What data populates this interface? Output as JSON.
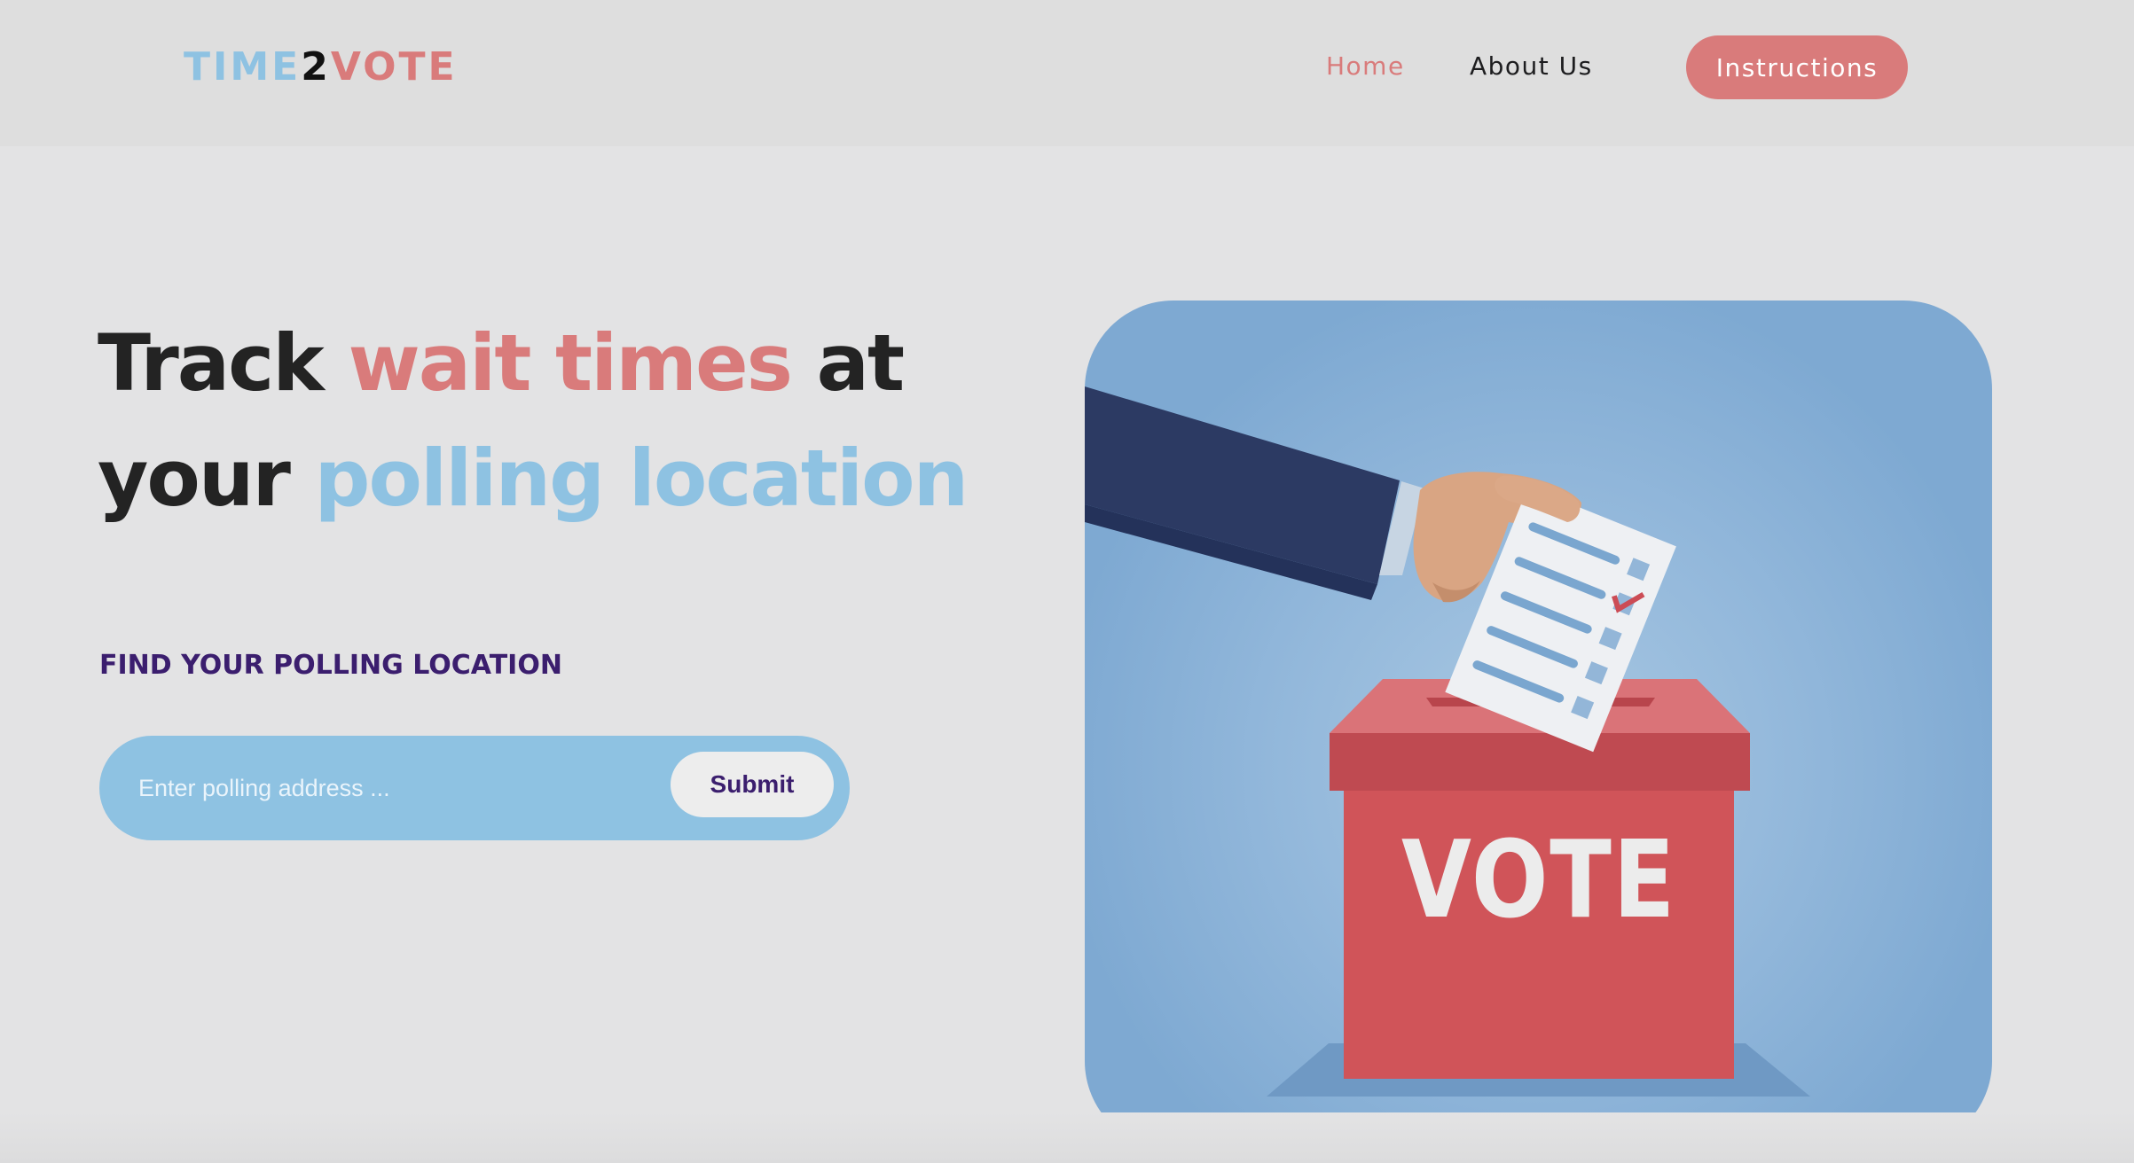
{
  "colors": {
    "pink": "#d97b7b",
    "blue": "#8ec2e2",
    "dark": "#232323",
    "purple": "#3b1e6e",
    "page_bg": "#e3e3e4",
    "nav_bg": "#dedede"
  },
  "header": {
    "logo": {
      "part1": "TIME",
      "part2": "2",
      "part3": "VOTE"
    },
    "nav": {
      "home_label": "Home",
      "about_label": "About Us",
      "instructions_label": "Instructions"
    }
  },
  "hero": {
    "title_parts": [
      "Track ",
      "wait times",
      " at your ",
      "polling location"
    ],
    "subtitle": "FIND YOUR POLLING LOCATION",
    "search": {
      "placeholder": "Enter polling address ...",
      "value": "",
      "submit_label": "Submit"
    }
  },
  "illustration": {
    "ballot_box_label": "VOTE",
    "icon": "hand-casting-ballot-illustration"
  }
}
